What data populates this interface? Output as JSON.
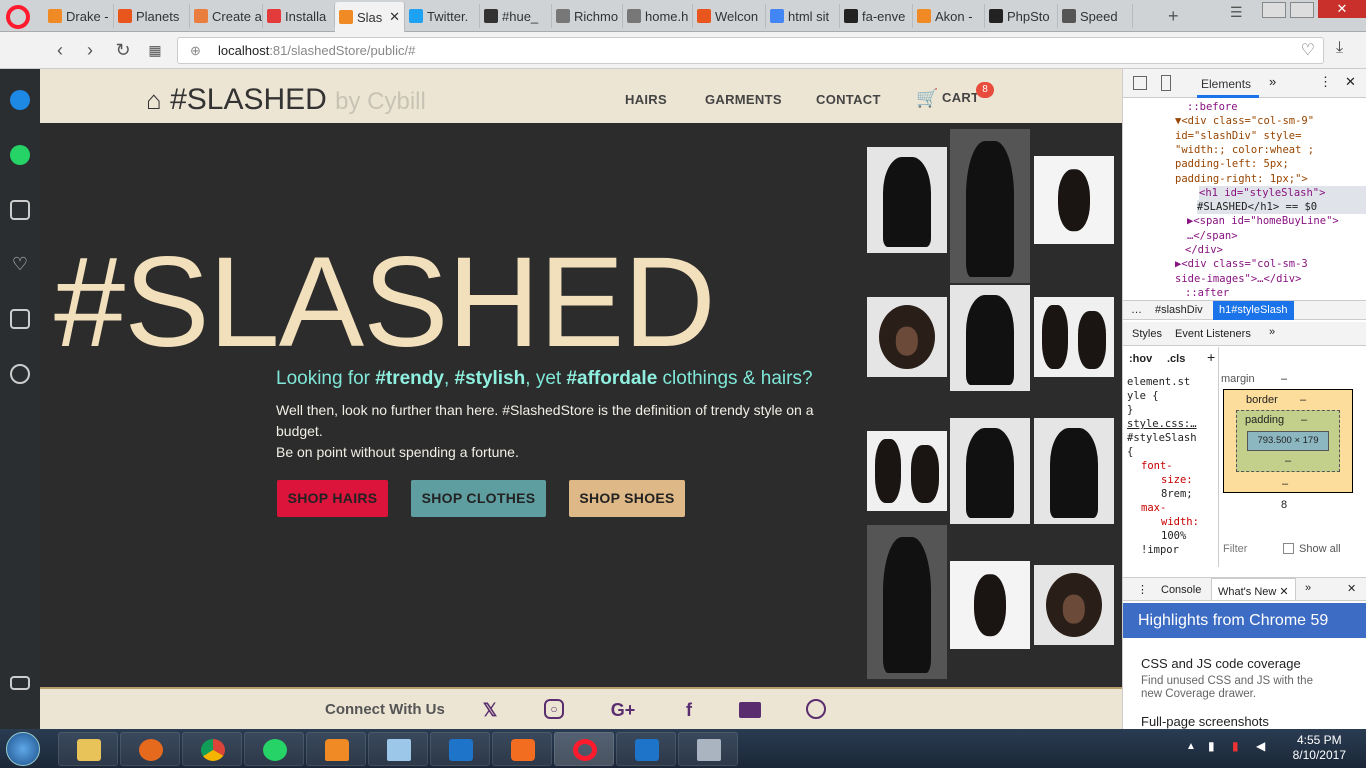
{
  "browser": {
    "tabs": [
      {
        "label": "Drake -",
        "color": "#f08a24"
      },
      {
        "label": "Planets",
        "color": "#e8561e"
      },
      {
        "label": "Create a",
        "color": "#e87d3e"
      },
      {
        "label": "Installa",
        "color": "#e33b3b"
      },
      {
        "label": "Slas",
        "color": "#f08a24"
      },
      {
        "label": "Twitter.",
        "color": "#1da1f2"
      },
      {
        "label": "#hue_",
        "color": "#333333"
      },
      {
        "label": "Richmo",
        "color": "#777777"
      },
      {
        "label": "home.h",
        "color": "#777777"
      },
      {
        "label": "Welcon",
        "color": "#e8561e"
      },
      {
        "label": "html sit",
        "color": "#4285f4"
      },
      {
        "label": "fa-enve",
        "color": "#222222"
      },
      {
        "label": "Akon -",
        "color": "#f08a24"
      },
      {
        "label": "PhpSto",
        "color": "#222222"
      },
      {
        "label": "Speed",
        "color": "#555555"
      }
    ],
    "url_host": "localhost",
    "url_path": ":81/slashedStore/public/#"
  },
  "site": {
    "brand": "#SLASHED",
    "brand_by": "by Cybill",
    "nav": [
      "HAIRS",
      "GARMENTS",
      "CONTACT",
      "CART"
    ],
    "cart_count": "8",
    "hero_title": "#SLASHED",
    "tagline_pre": "Looking for ",
    "tagline_b1": "#trendy",
    "tagline_c1": ", ",
    "tagline_b2": "#stylish",
    "tagline_c2": ", yet ",
    "tagline_b3": "#affordale",
    "tagline_post": " clothings & hairs?",
    "desc1": "Well then, look no further than here. #SlashedStore is the definition of trendy style on a budget.",
    "desc2": "Be on point without spending a fortune.",
    "buttons": [
      {
        "label": "SHOP HAIRS",
        "color": "#dc143c",
        "text": "#222"
      },
      {
        "label": "SHOP CLOTHES",
        "color": "#5f9ea0",
        "text": "#222"
      },
      {
        "label": "SHOP SHOES",
        "color": "#deb887",
        "text": "#222"
      }
    ],
    "footer_label": "Connect With Us",
    "social": [
      "twitter-icon",
      "instagram-icon",
      "google-plus-icon",
      "facebook-icon",
      "envelope-icon",
      "whatsapp-icon"
    ]
  },
  "devtools": {
    "tab_elements": "Elements",
    "html_lines": [
      "::before",
      "▼<div class=\"col-sm-9\"",
      "id=\"slashDiv\" style=",
      "\"width:; color:wheat ;",
      "padding-left: 5px;",
      "padding-right: 1px;\">",
      "<h1 id=\"styleSlash\">",
      "#SLASHED</h1> == $0",
      "▶<span id=\"homeBuyLine\">",
      "…</span>",
      "</div>",
      "▶<div class=\"col-sm-3",
      "side-images\">…</div>",
      "::after"
    ],
    "crumb1": "#slashDiv",
    "crumb2": "h1#styleSlash",
    "tab_styles": "Styles",
    "tab_listeners": "Event Listeners",
    "hov": ":hov",
    "cls": ".cls",
    "style_lines": [
      "element.st",
      "yle {",
      "}",
      "style.css:…",
      "#styleSlash",
      "{",
      "font-",
      "size:",
      "8rem;",
      "max-",
      "width:",
      "100%",
      "!impor"
    ],
    "box_margin": "margin",
    "box_border": "border",
    "box_padding": "padding",
    "box_size": "793.500 × 179",
    "box_bottom": "8",
    "dash": "–",
    "filter": "Filter",
    "show_all": "Show all",
    "drawer_console": "Console",
    "drawer_whatsnew": "What's New",
    "highlight": "Highlights from Chrome 59",
    "item1_title": "CSS and JS code coverage",
    "item1_desc": "Find unused CSS and JS with the new Coverage drawer.",
    "item2_title": "Full-page screenshots"
  },
  "taskbar": {
    "time": "4:55 PM",
    "date": "8/10/2017"
  }
}
